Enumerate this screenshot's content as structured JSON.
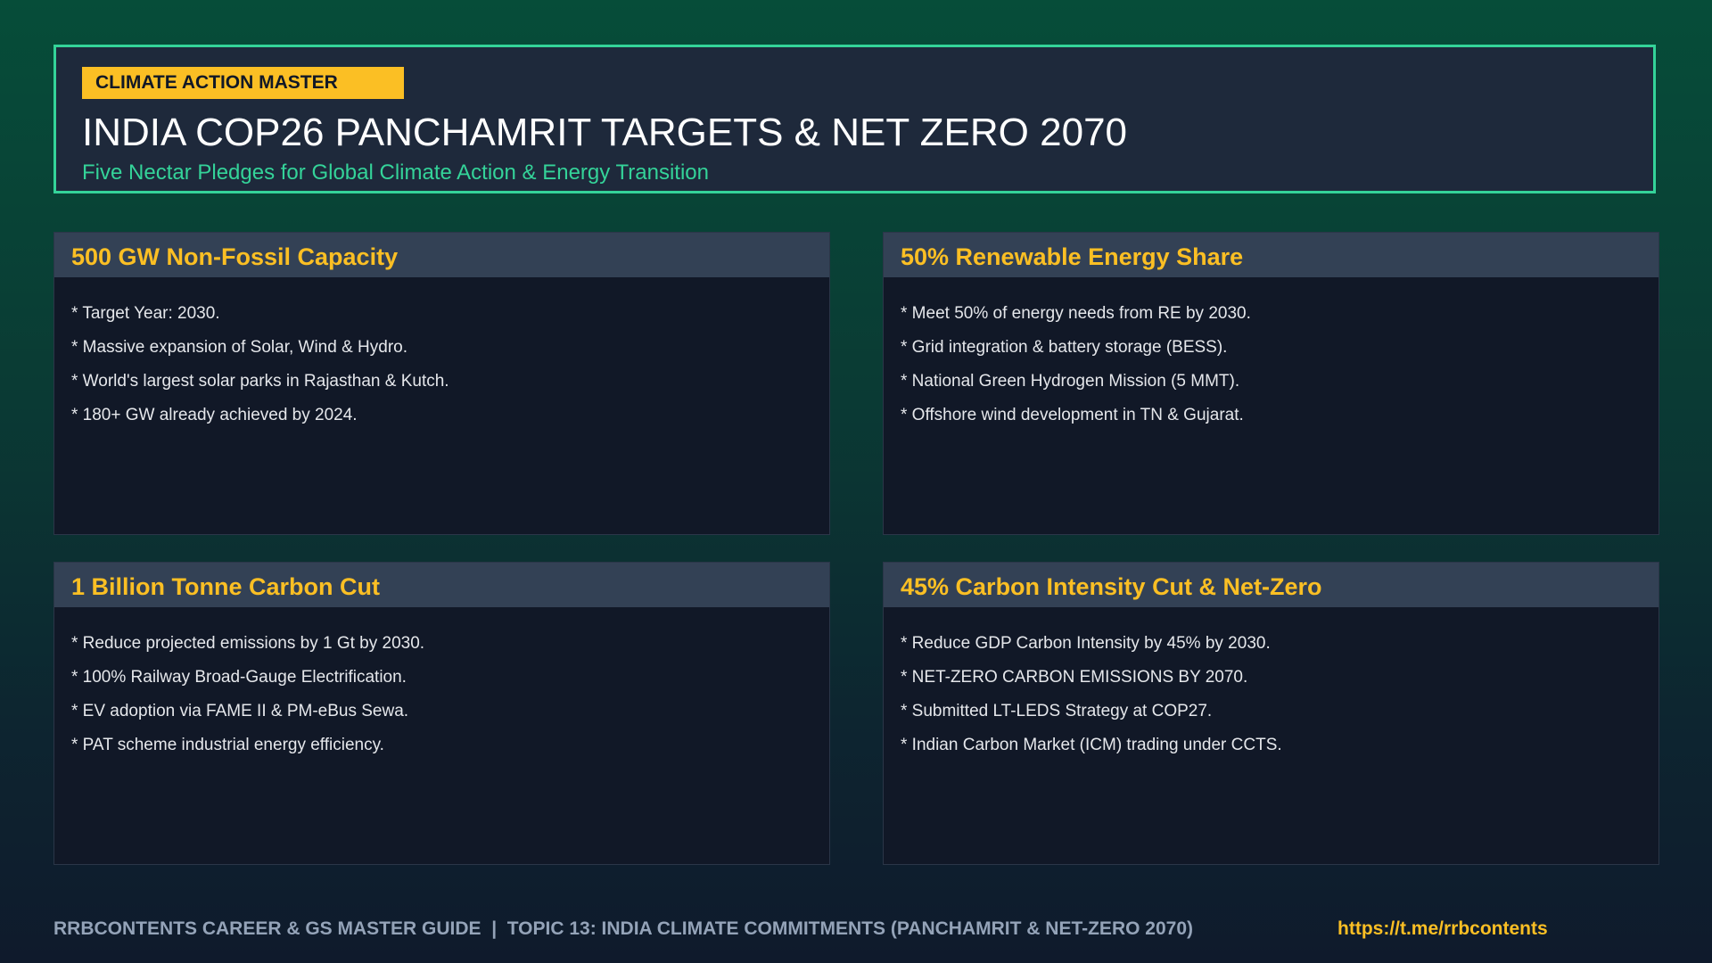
{
  "header": {
    "badge": "CLIMATE ACTION MASTER",
    "title": "INDIA COP26 PANCHAMRIT TARGETS & NET ZERO 2070",
    "subtitle": "Five Nectar Pledges for Global Climate Action & Energy Transition"
  },
  "cards": [
    {
      "title": "500 GW Non-Fossil Capacity",
      "items": [
        "* Target Year: 2030.",
        "* Massive expansion of Solar, Wind & Hydro.",
        "* World's largest solar parks in Rajasthan & Kutch.",
        "* 180+ GW already achieved by 2024."
      ]
    },
    {
      "title": "50% Renewable Energy Share",
      "items": [
        "* Meet 50% of energy needs from RE by 2030.",
        "* Grid integration & battery storage (BESS).",
        "* National Green Hydrogen Mission (5 MMT).",
        "* Offshore wind development in TN & Gujarat."
      ]
    },
    {
      "title": "1 Billion Tonne Carbon Cut",
      "items": [
        "* Reduce projected emissions by 1 Gt by 2030.",
        "* 100% Railway Broad-Gauge Electrification.",
        "* EV adoption via FAME II & PM-eBus Sewa.",
        "* PAT scheme industrial energy efficiency."
      ]
    },
    {
      "title": "45% Carbon Intensity Cut & Net-Zero",
      "items": [
        "* Reduce GDP Carbon Intensity by 45% by 2030.",
        "* NET-ZERO CARBON EMISSIONS BY 2070.",
        "* Submitted LT-LEDS Strategy at COP27.",
        "* Indian Carbon Market (ICM) trading under CCTS."
      ]
    }
  ],
  "footer": {
    "text": "RRBCONTENTS CAREER & GS MASTER GUIDE  |  TOPIC 13: INDIA CLIMATE COMMITMENTS (PANCHAMRIT & NET-ZERO 2070)",
    "link": "https://t.me/rrbcontents"
  },
  "colors": {
    "accent": "#34d399",
    "highlight": "#fbbf24",
    "card_bg": "#111827",
    "card_header_bg": "#334155",
    "header_bg": "#1e293b"
  }
}
